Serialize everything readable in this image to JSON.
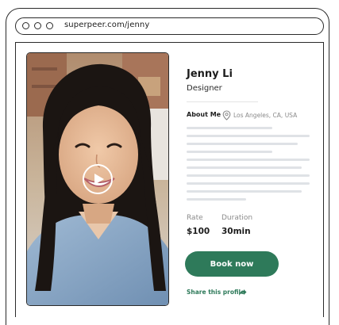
{
  "browser": {
    "url": "superpeer.com/jenny"
  },
  "profile": {
    "name": "Jenny Li",
    "role": "Designer",
    "about_label": "About Me",
    "location": "Los Angeles, CA, USA"
  },
  "stats": {
    "rate_label": "Rate",
    "rate_value": "$100",
    "duration_label": "Duration",
    "duration_value": "30min"
  },
  "actions": {
    "book_label": "Book now",
    "share_label": "Share this profile"
  },
  "colors": {
    "accent": "#2e7a5a",
    "placeholder_line": "#dfe2e6",
    "outline": "#2a2a2a"
  },
  "icons": {
    "play": "play-icon",
    "location": "map-pin-icon",
    "share": "share-arrow-icon"
  }
}
